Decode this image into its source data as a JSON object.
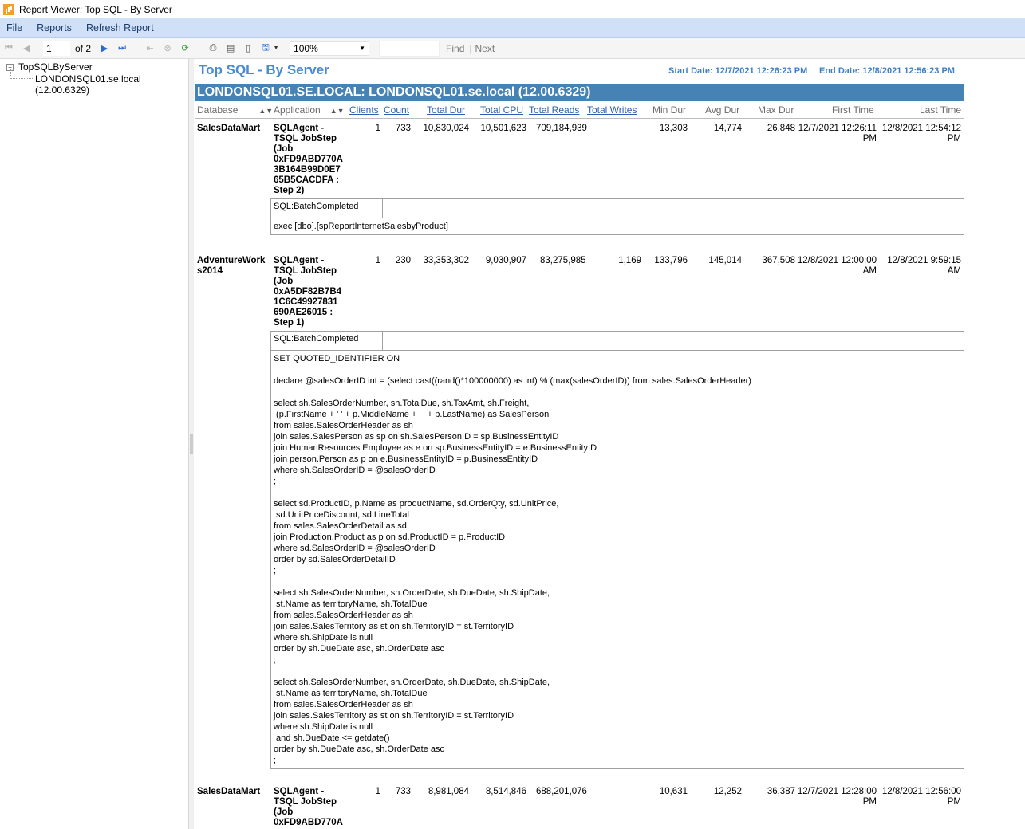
{
  "window": {
    "title": "Report Viewer: Top SQL - By Server"
  },
  "menu": {
    "items": [
      "File",
      "Reports",
      "Refresh Report"
    ]
  },
  "toolbar": {
    "page_current": "1",
    "page_of": "of",
    "page_total": "2",
    "zoom": "100%",
    "find_label": "Find",
    "next_label": "Next",
    "separator": "|"
  },
  "tree": {
    "root": "TopSQLByServer",
    "child": "LONDONSQL01.se.local (12.00.6329)"
  },
  "report": {
    "title": "Top SQL - By Server",
    "start_date": "Start Date: 12/7/2021 12:26:23 PM",
    "end_date": "End Date: 12/8/2021 12:56:23 PM",
    "banner": "LONDONSQL01.SE.LOCAL:  LONDONSQL01.se.local (12.00.6329)",
    "columns": {
      "database": "Database",
      "application": "Application",
      "clients": "Clients",
      "count": "Count",
      "total_dur": "Total Dur",
      "total_cpu": "Total CPU",
      "total_reads": "Total Reads",
      "total_writes": "Total Writes",
      "min_dur": "Min Dur",
      "avg_dur": "Avg Dur",
      "max_dur": "Max Dur",
      "first_time": "First  Time",
      "last_time": "Last  Time"
    },
    "rows": [
      {
        "database": "SalesDataMart",
        "application": "SQLAgent -\nTSQL JobStep\n(Job\n0xFD9ABD770A\n3B164B99D0E7\n65B5CACDFA :\nStep 2)",
        "clients": "1",
        "count": "733",
        "total_dur": "10,830,024",
        "total_cpu": "10,501,623",
        "total_reads": "709,184,939",
        "total_writes": "",
        "min_dur": "13,303",
        "avg_dur": "14,774",
        "max_dur": "26,848",
        "first_time": "12/7/2021 12:26:11\nPM",
        "last_time": "12/8/2021 12:54:12\nPM",
        "event": "SQL:BatchCompleted",
        "sql": "exec [dbo].[spReportInternetSalesbyProduct]"
      },
      {
        "database": "AdventureWork\ns2014",
        "application": "SQLAgent -\nTSQL JobStep\n(Job\n0xA5DF82B7B4\n1C6C49927831\n690AE26015 :\nStep 1)",
        "clients": "1",
        "count": "230",
        "total_dur": "33,353,302",
        "total_cpu": "9,030,907",
        "total_reads": "83,275,985",
        "total_writes": "1,169",
        "min_dur": "133,796",
        "avg_dur": "145,014",
        "max_dur": "367,508",
        "first_time": "12/8/2021 12:00:00\nAM",
        "last_time": "12/8/2021 9:59:15\nAM",
        "event": "SQL:BatchCompleted",
        "sql": "SET QUOTED_IDENTIFIER ON\n\ndeclare @salesOrderID int = (select cast((rand()*100000000) as int) % (max(salesOrderID)) from sales.SalesOrderHeader)\n\nselect sh.SalesOrderNumber, sh.TotalDue, sh.TaxAmt, sh.Freight,\n (p.FirstName + ' ' + p.MiddleName + ' ' + p.LastName) as SalesPerson\nfrom sales.SalesOrderHeader as sh\njoin sales.SalesPerson as sp on sh.SalesPersonID = sp.BusinessEntityID\njoin HumanResources.Employee as e on sp.BusinessEntityID = e.BusinessEntityID\njoin person.Person as p on e.BusinessEntityID = p.BusinessEntityID\nwhere sh.SalesOrderID = @salesOrderID\n;\n\nselect sd.ProductID, p.Name as productName, sd.OrderQty, sd.UnitPrice,\n sd.UnitPriceDiscount, sd.LineTotal\nfrom sales.SalesOrderDetail as sd\njoin Production.Product as p on sd.ProductID = p.ProductID\nwhere sd.SalesOrderID = @salesOrderID\norder by sd.SalesOrderDetailID\n;\n\nselect sh.SalesOrderNumber, sh.OrderDate, sh.DueDate, sh.ShipDate,\n st.Name as territoryName, sh.TotalDue\nfrom sales.SalesOrderHeader as sh\njoin sales.SalesTerritory as st on sh.TerritoryID = st.TerritoryID\nwhere sh.ShipDate is null\norder by sh.DueDate asc, sh.OrderDate asc\n;\n\nselect sh.SalesOrderNumber, sh.OrderDate, sh.DueDate, sh.ShipDate,\n st.Name as territoryName, sh.TotalDue\nfrom sales.SalesOrderHeader as sh\njoin sales.SalesTerritory as st on sh.TerritoryID = st.TerritoryID\nwhere sh.ShipDate is null\n and sh.DueDate <= getdate()\norder by sh.DueDate asc, sh.OrderDate asc\n;"
      },
      {
        "database": "SalesDataMart",
        "application": "SQLAgent -\nTSQL JobStep\n(Job\n0xFD9ABD770A",
        "clients": "1",
        "count": "733",
        "total_dur": "8,981,084",
        "total_cpu": "8,514,846",
        "total_reads": "688,201,076",
        "total_writes": "",
        "min_dur": "10,631",
        "avg_dur": "12,252",
        "max_dur": "36,387",
        "first_time": "12/7/2021 12:28:00\nPM",
        "last_time": "12/8/2021 12:56:00\nPM"
      }
    ]
  }
}
